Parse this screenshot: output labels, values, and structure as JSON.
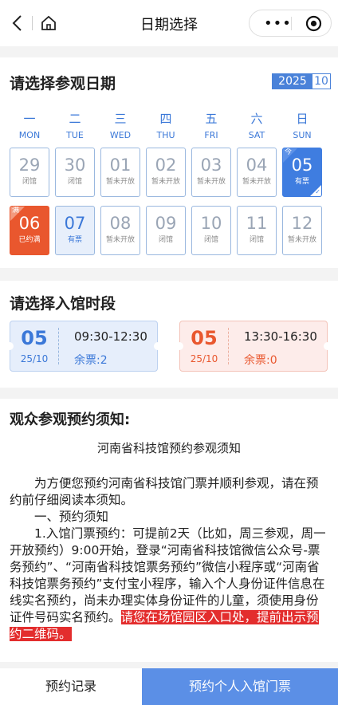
{
  "nav": {
    "title": "日期选择"
  },
  "date_section": {
    "heading": "请选择参观日期",
    "year": "2025",
    "month": "10",
    "weekdays": [
      {
        "cn": "一",
        "en": "MON"
      },
      {
        "cn": "二",
        "en": "TUE"
      },
      {
        "cn": "三",
        "en": "WED"
      },
      {
        "cn": "四",
        "en": "THU"
      },
      {
        "cn": "五",
        "en": "FRI"
      },
      {
        "cn": "六",
        "en": "SAT"
      },
      {
        "cn": "日",
        "en": "SUN"
      }
    ],
    "days": [
      {
        "num": "29",
        "status": "闭馆",
        "state": "closed"
      },
      {
        "num": "30",
        "status": "闭馆",
        "state": "closed"
      },
      {
        "num": "01",
        "status": "暂未开放",
        "state": "closed"
      },
      {
        "num": "02",
        "status": "暂未开放",
        "state": "closed"
      },
      {
        "num": "03",
        "status": "暂未开放",
        "state": "closed"
      },
      {
        "num": "04",
        "status": "暂未开放",
        "state": "closed"
      },
      {
        "num": "05",
        "status": "有票",
        "state": "selected",
        "tag": "今"
      },
      {
        "num": "06",
        "status": "已约满",
        "state": "full",
        "tag": "满"
      },
      {
        "num": "07",
        "status": "有票",
        "state": "available"
      },
      {
        "num": "08",
        "status": "暂未开放",
        "state": "closed"
      },
      {
        "num": "09",
        "status": "闭馆",
        "state": "closed"
      },
      {
        "num": "10",
        "status": "闭馆",
        "state": "closed"
      },
      {
        "num": "11",
        "status": "闭馆",
        "state": "closed"
      },
      {
        "num": "12",
        "status": "暂未开放",
        "state": "closed"
      }
    ]
  },
  "slot_section": {
    "heading": "请选择入馆时段",
    "slots": [
      {
        "day": "05",
        "date": "25/10",
        "time": "09:30-12:30",
        "tickets": "余票:2"
      },
      {
        "day": "05",
        "date": "25/10",
        "time": "13:30-16:30",
        "tickets": "余票:0"
      }
    ]
  },
  "notice": {
    "heading": "观众参观预约须知:",
    "title": "河南省科技馆预约参观须知",
    "intro": "为方便您预约河南省科技馆门票并顺利参观，请在预约前仔细阅读本须知。",
    "section1": "一、预约须知",
    "item1": "1.入馆门票预约：可提前2天（比如，周三参观，周一开放预约）9:00开始，登录“河南省科技馆微信公众号-票务预约”、“河南省科技馆票务预约”微信小程序或“河南省科技馆票务预约”支付宝小程序，输入个人身份证件信息在线实名预约，尚未办理实体身份证件的儿童，须使用身份证件号码实名预约。",
    "item1_highlight": "请您在场馆园区入口处，提前出示预约二维码。"
  },
  "bottom": {
    "record": "预约记录",
    "book": "预约个人入馆门票"
  },
  "colors": {
    "accent": "#3f7de0",
    "full": "#e9572e",
    "highlight": "#e32d2d"
  }
}
